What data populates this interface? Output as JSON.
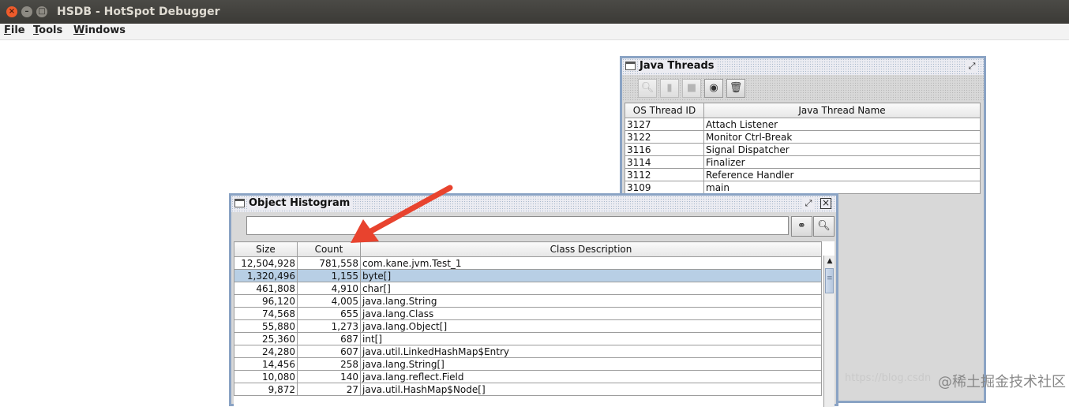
{
  "window": {
    "title": "HSDB - HotSpot Debugger"
  },
  "menu": [
    {
      "mnemonic": "F",
      "rest": "ile"
    },
    {
      "mnemonic": "T",
      "rest": "ools"
    },
    {
      "mnemonic": "W",
      "rest": "indows"
    }
  ],
  "java_threads": {
    "title": "Java Threads",
    "columns": [
      "OS Thread ID",
      "Java Thread Name"
    ],
    "rows": [
      [
        "3127",
        "Attach Listener"
      ],
      [
        "3122",
        "Monitor Ctrl-Break"
      ],
      [
        "3116",
        "Signal Dispatcher"
      ],
      [
        "3114",
        "Finalizer"
      ],
      [
        "3112",
        "Reference Handler"
      ],
      [
        "3109",
        "main"
      ]
    ],
    "toolbar_icons": [
      "inspect-icon",
      "stack-icon",
      "memory-icon",
      "info-icon",
      "trash-icon"
    ]
  },
  "object_histogram": {
    "title": "Object Histogram",
    "search_value": "",
    "columns": [
      "Size",
      "Count",
      "Class Description"
    ],
    "selected_row": 1,
    "rows": [
      [
        "12,504,928",
        "781,558",
        "com.kane.jvm.Test_1"
      ],
      [
        "1,320,496",
        "1,155",
        "byte[]"
      ],
      [
        "461,808",
        "4,910",
        "char[]"
      ],
      [
        "96,120",
        "4,005",
        "java.lang.String"
      ],
      [
        "74,568",
        "655",
        "java.lang.Class"
      ],
      [
        "55,880",
        "1,273",
        "java.lang.Object[]"
      ],
      [
        "25,360",
        "687",
        "int[]"
      ],
      [
        "24,280",
        "607",
        "java.util.LinkedHashMap$Entry"
      ],
      [
        "14,456",
        "258",
        "java.lang.String[]"
      ],
      [
        "10,080",
        "140",
        "java.lang.reflect.Field"
      ],
      [
        "9,872",
        "27",
        "java.util.HashMap$Node[]"
      ]
    ]
  },
  "colors": {
    "selection": "#b8cfe5",
    "frame_border": "#8aa3c4",
    "annotation_arrow": "#e8432e"
  },
  "watermark": {
    "url": "https://blog.csdn",
    "brand": "@稀土掘金技术社区"
  }
}
